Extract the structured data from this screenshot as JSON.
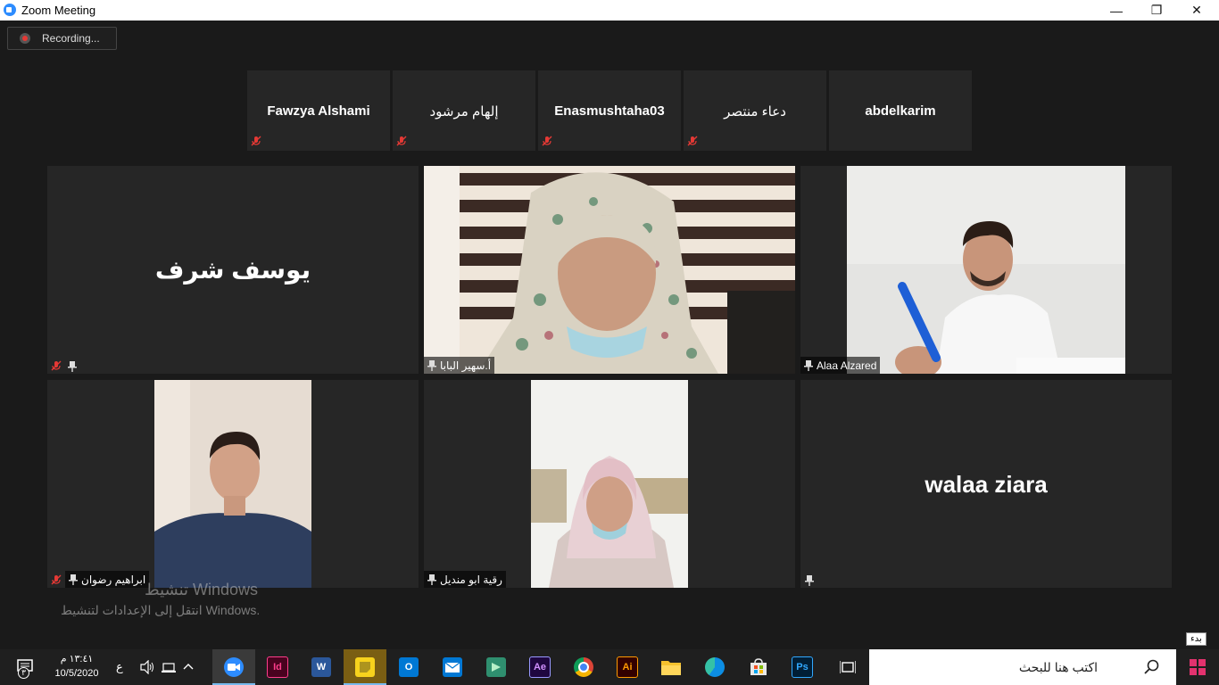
{
  "window": {
    "title": "Zoom Meeting",
    "minimize": "—",
    "restore": "❐",
    "close": "✕"
  },
  "recording": {
    "label": "Recording..."
  },
  "thumbnails": [
    {
      "name": "Fawzya Alshami"
    },
    {
      "name": "إلهام مرشود"
    },
    {
      "name": "Enasmushtaha03"
    },
    {
      "name": "دعاء منتصر"
    },
    {
      "name": "abdelkarim"
    }
  ],
  "tiles": {
    "yousef": {
      "big_name": "يوسف شرف"
    },
    "suhair": {
      "label": "أ.سهير البابا"
    },
    "alaa": {
      "label": "Alaa Alzared"
    },
    "ibrahim": {
      "label": "ابراهيم رضوان"
    },
    "ruqaya": {
      "label": "رقية ابو منديل"
    },
    "walaa": {
      "big_name": "walaa ziara"
    }
  },
  "watermark": {
    "line1": "تنشيط Windows",
    "line2": "انتقل إلى الإعدادات لتنشيط Windows."
  },
  "tooltip": {
    "text": "بدء"
  },
  "taskbar": {
    "search_placeholder": "اكتب هنا للبحث",
    "clock_time": "١٣:٤١ م",
    "clock_date": "10/5/2020",
    "notification_count": "٣",
    "lang": "ع",
    "apps": [
      {
        "label": "",
        "color": "#2d8cff",
        "name": "zoom"
      },
      {
        "label": "Id",
        "color": "#49021f",
        "name": "indesign"
      },
      {
        "label": "W",
        "color": "#2b579a",
        "name": "word"
      },
      {
        "label": "",
        "color": "#f7d21d",
        "name": "sticky-notes"
      },
      {
        "label": "O",
        "color": "#0078d4",
        "name": "outlook"
      },
      {
        "label": "",
        "color": "#0078d4",
        "name": "mail"
      },
      {
        "label": "",
        "color": "#2f8f6f",
        "name": "filmora"
      },
      {
        "label": "Ae",
        "color": "#1f0740",
        "name": "after-effects"
      },
      {
        "label": "",
        "color": "#db4437",
        "name": "chrome"
      },
      {
        "label": "Ai",
        "color": "#330000",
        "name": "illustrator"
      },
      {
        "label": "",
        "color": "#f5c12e",
        "name": "file-explorer"
      },
      {
        "label": "",
        "color": "#0c8de3",
        "name": "edge"
      },
      {
        "label": "",
        "color": "#555555",
        "name": "store"
      },
      {
        "label": "Ps",
        "color": "#001e36",
        "name": "photoshop"
      }
    ]
  }
}
